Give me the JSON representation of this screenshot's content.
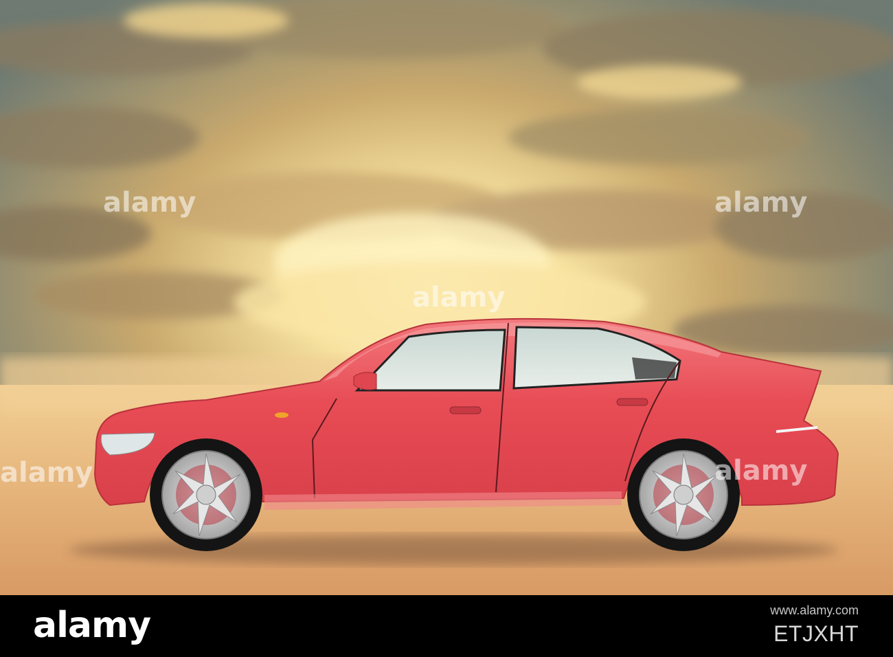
{
  "photo": {
    "subject": "red sedan car side view against cloudy sunset sky",
    "colors": {
      "sky_top": "#5b6a6a",
      "sky_glow": "#fff2b8",
      "ground": "#e9b27a",
      "car_body": "#e8484f",
      "tire": "#1a1a1a",
      "rim": "#d9d9d9"
    }
  },
  "watermark": {
    "text": "alamy"
  },
  "footer": {
    "logo_text": "alamy",
    "image_id": "ETJXHT",
    "url": "www.alamy.com"
  }
}
